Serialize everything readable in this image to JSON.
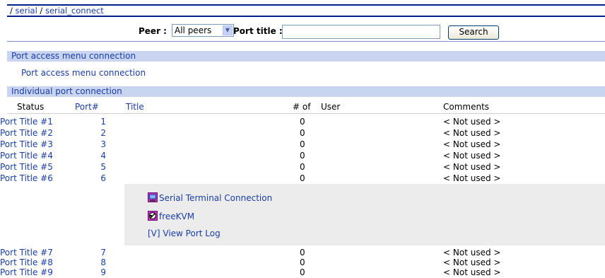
{
  "breadcrumb": {
    "sep1": "/",
    "serial": "serial",
    "sep2": "/",
    "current": "serial_connect"
  },
  "search": {
    "peer_label": "Peer :",
    "peer_selected": "All peers",
    "port_title_label": "Port title :",
    "port_title_value": "",
    "search_button": "Search"
  },
  "sections": {
    "menu_section": "Port access menu connection",
    "menu_link": "Port access menu connection",
    "individual_section": "Individual port connection"
  },
  "columns": {
    "status": "Status",
    "port": "Port#",
    "title": "Title",
    "num": "# of",
    "user": "User",
    "comments": "Comments"
  },
  "ports": [
    {
      "port": "1",
      "title": "Port Title #1",
      "num": "0",
      "comment": "< Not used >"
    },
    {
      "port": "2",
      "title": "Port Title #2",
      "num": "0",
      "comment": "< Not used >"
    },
    {
      "port": "3",
      "title": "Port Title #3",
      "num": "0",
      "comment": "< Not used >"
    },
    {
      "port": "4",
      "title": "Port Title #4",
      "num": "0",
      "comment": "< Not used >"
    },
    {
      "port": "5",
      "title": "Port Title #5",
      "num": "0",
      "comment": "< Not used >"
    },
    {
      "port": "6",
      "title": "Port Title #6",
      "num": "0",
      "comment": "< Not used >"
    },
    {
      "port": "7",
      "title": "Port Title #7",
      "num": "0",
      "comment": "< Not used >"
    },
    {
      "port": "8",
      "title": "Port Title #8",
      "num": "0",
      "comment": "< Not used >"
    },
    {
      "port": "9",
      "title": "Port Title #9",
      "num": "0",
      "comment": "< Not used >"
    }
  ],
  "expanded": {
    "serial_terminal": "Serial Terminal Connection",
    "freekvm": "freeKVM",
    "view_log": "[V] View Port Log"
  },
  "colors": {
    "link": "#1a3ea6",
    "section_bg": "#c8d4f0",
    "border": "#00208c",
    "expand_bg": "#ececec"
  }
}
